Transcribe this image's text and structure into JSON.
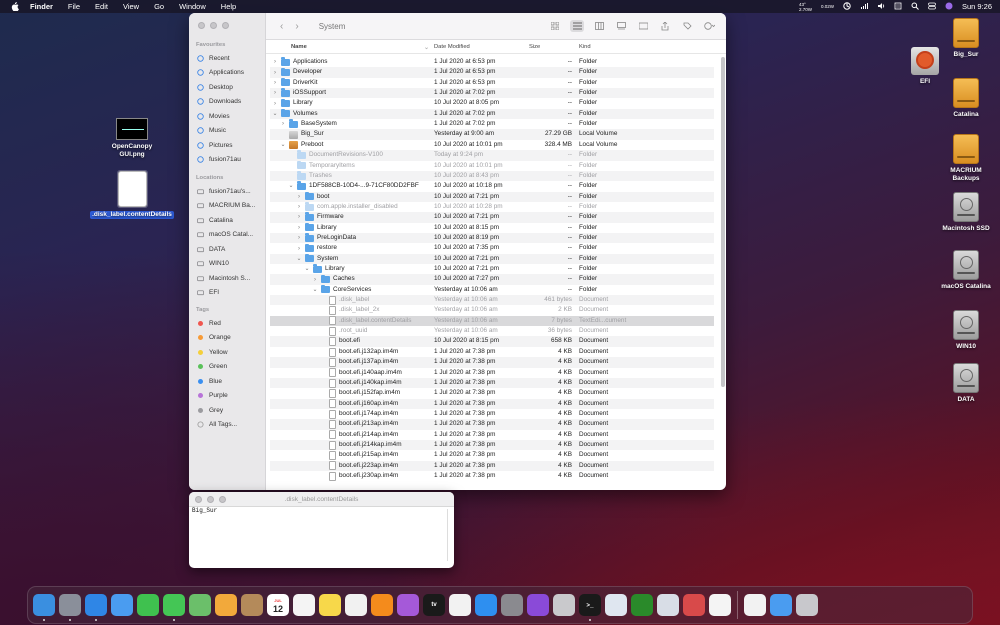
{
  "menubar": {
    "app": "Finder",
    "items": [
      "File",
      "Edit",
      "View",
      "Go",
      "Window",
      "Help"
    ],
    "temp": "43°",
    "temp_sub": "2.70W",
    "power": "0.02W",
    "clock": "Sun 9:26"
  },
  "finder": {
    "title": "System",
    "sidebar": {
      "favourites_head": "Favourites",
      "favourites": [
        "Recent",
        "Applications",
        "Desktop",
        "Downloads",
        "Movies",
        "Music",
        "Pictures",
        "fusion71au"
      ],
      "locations_head": "Locations",
      "locations": [
        "fusion71au's...",
        "MACRIUM Ba...",
        "Catalina",
        "macOS Catal...",
        "DATA",
        "WIN10",
        "Macintosh S...",
        "EFI"
      ],
      "tags_head": "Tags",
      "tags": [
        {
          "label": "Red",
          "color": "#f0564f"
        },
        {
          "label": "Orange",
          "color": "#f79a36"
        },
        {
          "label": "Yellow",
          "color": "#f4cf3a"
        },
        {
          "label": "Green",
          "color": "#5ac15a"
        },
        {
          "label": "Blue",
          "color": "#3a8ff0"
        },
        {
          "label": "Purple",
          "color": "#b874d8"
        },
        {
          "label": "Grey",
          "color": "#9b9b9f"
        },
        {
          "label": "All Tags...",
          "color": ""
        }
      ]
    },
    "columns": {
      "name": "Name",
      "date": "Date Modified",
      "size": "Size",
      "kind": "Kind"
    },
    "rows": [
      {
        "indent": 0,
        "chev": ">",
        "icon": "folder",
        "name": "Applications",
        "date": "1 Jul 2020 at 6:53 pm",
        "size": "--",
        "kind": "Folder"
      },
      {
        "indent": 0,
        "chev": ">",
        "icon": "folder",
        "name": "Developer",
        "date": "1 Jul 2020 at 6:53 pm",
        "size": "--",
        "kind": "Folder"
      },
      {
        "indent": 0,
        "chev": ">",
        "icon": "folder",
        "name": "DriverKit",
        "date": "1 Jul 2020 at 6:53 pm",
        "size": "--",
        "kind": "Folder"
      },
      {
        "indent": 0,
        "chev": ">",
        "icon": "folder",
        "name": "iOSSupport",
        "date": "1 Jul 2020 at 7:02 pm",
        "size": "--",
        "kind": "Folder"
      },
      {
        "indent": 0,
        "chev": ">",
        "icon": "folder",
        "name": "Library",
        "date": "10 Jul 2020 at 8:05 pm",
        "size": "--",
        "kind": "Folder"
      },
      {
        "indent": 0,
        "chev": "v",
        "icon": "folder",
        "name": "Volumes",
        "date": "1 Jul 2020 at 7:02 pm",
        "size": "--",
        "kind": "Folder"
      },
      {
        "indent": 1,
        "chev": ">",
        "icon": "folder",
        "name": "BaseSystem",
        "date": "1 Jul 2020 at 7:02 pm",
        "size": "--",
        "kind": "Folder"
      },
      {
        "indent": 1,
        "chev": "",
        "icon": "disk-grey",
        "name": "Big_Sur",
        "date": "Yesterday at 9:00 am",
        "size": "27.29 GB",
        "kind": "Local Volume"
      },
      {
        "indent": 1,
        "chev": "v",
        "icon": "disk",
        "name": "Preboot",
        "date": "10 Jul 2020 at 10:01 pm",
        "size": "328.4 MB",
        "kind": "Local Volume"
      },
      {
        "indent": 2,
        "chev": "",
        "icon": "folder-light",
        "name": "DocumentRevisions-V100",
        "date": "Today at 9:24 pm",
        "size": "--",
        "kind": "Folder",
        "grey": true
      },
      {
        "indent": 2,
        "chev": "",
        "icon": "folder-light",
        "name": "TemporaryItems",
        "date": "10 Jul 2020 at 10:01 pm",
        "size": "--",
        "kind": "Folder",
        "grey": true
      },
      {
        "indent": 2,
        "chev": "",
        "icon": "folder-light",
        "name": "Trashes",
        "date": "10 Jul 2020 at 8:43 pm",
        "size": "--",
        "kind": "Folder",
        "grey": true
      },
      {
        "indent": 2,
        "chev": "v",
        "icon": "folder",
        "name": "1DF588CB-10D4-...9-71CF80DD2FBF",
        "date": "10 Jul 2020 at 10:18 pm",
        "size": "--",
        "kind": "Folder"
      },
      {
        "indent": 3,
        "chev": ">",
        "icon": "folder",
        "name": "boot",
        "date": "10 Jul 2020 at 7:21 pm",
        "size": "--",
        "kind": "Folder"
      },
      {
        "indent": 3,
        "chev": ">",
        "icon": "folder-light",
        "name": "com.apple.installer_disabled",
        "date": "10 Jul 2020 at 10:28 pm",
        "size": "--",
        "kind": "Folder",
        "grey": true
      },
      {
        "indent": 3,
        "chev": ">",
        "icon": "folder",
        "name": "Firmware",
        "date": "10 Jul 2020 at 7:21 pm",
        "size": "--",
        "kind": "Folder"
      },
      {
        "indent": 3,
        "chev": ">",
        "icon": "folder",
        "name": "Library",
        "date": "10 Jul 2020 at 8:15 pm",
        "size": "--",
        "kind": "Folder"
      },
      {
        "indent": 3,
        "chev": ">",
        "icon": "folder",
        "name": "PreLoginData",
        "date": "10 Jul 2020 at 8:19 pm",
        "size": "--",
        "kind": "Folder"
      },
      {
        "indent": 3,
        "chev": ">",
        "icon": "folder",
        "name": "restore",
        "date": "10 Jul 2020 at 7:35 pm",
        "size": "--",
        "kind": "Folder"
      },
      {
        "indent": 3,
        "chev": "v",
        "icon": "folder",
        "name": "System",
        "date": "10 Jul 2020 at 7:21 pm",
        "size": "--",
        "kind": "Folder"
      },
      {
        "indent": 4,
        "chev": "v",
        "icon": "folder",
        "name": "Library",
        "date": "10 Jul 2020 at 7:21 pm",
        "size": "--",
        "kind": "Folder"
      },
      {
        "indent": 5,
        "chev": ">",
        "icon": "folder",
        "name": "Caches",
        "date": "10 Jul 2020 at 7:27 pm",
        "size": "--",
        "kind": "Folder"
      },
      {
        "indent": 5,
        "chev": "v",
        "icon": "folder",
        "name": "CoreServices",
        "date": "Yesterday at 10:06 am",
        "size": "--",
        "kind": "Folder"
      },
      {
        "indent": 6,
        "chev": "",
        "icon": "doc",
        "name": ".disk_label",
        "date": "Yesterday at 10:06 am",
        "size": "461 bytes",
        "kind": "Document",
        "grey": true
      },
      {
        "indent": 6,
        "chev": "",
        "icon": "doc",
        "name": ".disk_label_2x",
        "date": "Yesterday at 10:06 am",
        "size": "2 KB",
        "kind": "Document",
        "grey": true
      },
      {
        "indent": 6,
        "chev": "",
        "icon": "doc",
        "name": ".disk_label.contentDetails",
        "date": "Yesterday at 10:06 am",
        "size": "7 bytes",
        "kind": "TextEdi...cument",
        "grey": true,
        "selected": true
      },
      {
        "indent": 6,
        "chev": "",
        "icon": "doc",
        "name": ".root_uuid",
        "date": "Yesterday at 10:06 am",
        "size": "36 bytes",
        "kind": "Document",
        "grey": true
      },
      {
        "indent": 6,
        "chev": "",
        "icon": "doc",
        "name": "boot.efi",
        "date": "10 Jul 2020 at 8:15 pm",
        "size": "658 KB",
        "kind": "Document"
      },
      {
        "indent": 6,
        "chev": "",
        "icon": "doc",
        "name": "boot.efi.j132ap.im4m",
        "date": "1 Jul 2020 at 7:38 pm",
        "size": "4 KB",
        "kind": "Document"
      },
      {
        "indent": 6,
        "chev": "",
        "icon": "doc",
        "name": "boot.efi.j137ap.im4m",
        "date": "1 Jul 2020 at 7:38 pm",
        "size": "4 KB",
        "kind": "Document"
      },
      {
        "indent": 6,
        "chev": "",
        "icon": "doc",
        "name": "boot.efi.j140aap.im4m",
        "date": "1 Jul 2020 at 7:38 pm",
        "size": "4 KB",
        "kind": "Document"
      },
      {
        "indent": 6,
        "chev": "",
        "icon": "doc",
        "name": "boot.efi.j140kap.im4m",
        "date": "1 Jul 2020 at 7:38 pm",
        "size": "4 KB",
        "kind": "Document"
      },
      {
        "indent": 6,
        "chev": "",
        "icon": "doc",
        "name": "boot.efi.j152fap.im4m",
        "date": "1 Jul 2020 at 7:38 pm",
        "size": "4 KB",
        "kind": "Document"
      },
      {
        "indent": 6,
        "chev": "",
        "icon": "doc",
        "name": "boot.efi.j160ap.im4m",
        "date": "1 Jul 2020 at 7:38 pm",
        "size": "4 KB",
        "kind": "Document"
      },
      {
        "indent": 6,
        "chev": "",
        "icon": "doc",
        "name": "boot.efi.j174ap.im4m",
        "date": "1 Jul 2020 at 7:38 pm",
        "size": "4 KB",
        "kind": "Document"
      },
      {
        "indent": 6,
        "chev": "",
        "icon": "doc",
        "name": "boot.efi.j213ap.im4m",
        "date": "1 Jul 2020 at 7:38 pm",
        "size": "4 KB",
        "kind": "Document"
      },
      {
        "indent": 6,
        "chev": "",
        "icon": "doc",
        "name": "boot.efi.j214ap.im4m",
        "date": "1 Jul 2020 at 7:38 pm",
        "size": "4 KB",
        "kind": "Document"
      },
      {
        "indent": 6,
        "chev": "",
        "icon": "doc",
        "name": "boot.efi.j214kap.im4m",
        "date": "1 Jul 2020 at 7:38 pm",
        "size": "4 KB",
        "kind": "Document"
      },
      {
        "indent": 6,
        "chev": "",
        "icon": "doc",
        "name": "boot.efi.j215ap.im4m",
        "date": "1 Jul 2020 at 7:38 pm",
        "size": "4 KB",
        "kind": "Document"
      },
      {
        "indent": 6,
        "chev": "",
        "icon": "doc",
        "name": "boot.efi.j223ap.im4m",
        "date": "1 Jul 2020 at 7:38 pm",
        "size": "4 KB",
        "kind": "Document"
      },
      {
        "indent": 6,
        "chev": "",
        "icon": "doc",
        "name": "boot.efi.j230ap.im4m",
        "date": "1 Jul 2020 at 7:38 pm",
        "size": "4 KB",
        "kind": "Document"
      }
    ]
  },
  "textedit": {
    "title": ".disk_label.contentDetails",
    "content": "Big_Sur"
  },
  "desktop": {
    "left_icons": [
      {
        "label": "OpenCanopy GUI.png"
      },
      {
        "label": ".disk_label.contentDetails"
      }
    ],
    "right_icons": [
      {
        "label": "Big_Sur",
        "icon": "hdd-orange"
      },
      {
        "label": "EFI",
        "icon": "efi-ubuntu"
      },
      {
        "label": "Catalina",
        "icon": "hdd-orange"
      },
      {
        "label": "MACRIUM Backups",
        "icon": "hdd-orange"
      },
      {
        "label": "Macintosh SSD",
        "icon": "hdd-grey"
      },
      {
        "label": "macOS Catalina",
        "icon": "hdd-grey"
      },
      {
        "label": "WIN10",
        "icon": "hdd-grey"
      },
      {
        "label": "DATA",
        "icon": "hdd-grey"
      }
    ]
  },
  "dock": {
    "apps": [
      {
        "name": "finder-icon",
        "color": "#3a8fe0"
      },
      {
        "name": "launchpad-icon",
        "color": "#8a8f9a"
      },
      {
        "name": "safari-icon",
        "color": "#2f86e6"
      },
      {
        "name": "mail-icon",
        "color": "#4a9cf0"
      },
      {
        "name": "facetime-icon",
        "color": "#3fc14f"
      },
      {
        "name": "messages-icon",
        "color": "#44c655"
      },
      {
        "name": "maps-icon",
        "color": "#6bbf6a"
      },
      {
        "name": "photos-icon",
        "color": "#f2a93b"
      },
      {
        "name": "contacts-icon",
        "color": "#b48a5a"
      },
      {
        "name": "calendar-icon",
        "color": "#ffffff"
      },
      {
        "name": "reminders-icon",
        "color": "#f4f4f4"
      },
      {
        "name": "notes-icon",
        "color": "#f7d84a"
      },
      {
        "name": "music-icon",
        "color": "#f1f1f1"
      },
      {
        "name": "vlc-icon",
        "color": "#f48b1c"
      },
      {
        "name": "podcasts-icon",
        "color": "#a559d9"
      },
      {
        "name": "tv-icon",
        "color": "#1a1a1a"
      },
      {
        "name": "news-icon",
        "color": "#f2f2f2"
      },
      {
        "name": "app-store-icon",
        "color": "#2e8ff0"
      },
      {
        "name": "system-preferences-icon",
        "color": "#8a8a8f"
      },
      {
        "name": "feedback-icon",
        "color": "#8a4ad8"
      },
      {
        "name": "disk-utility-icon",
        "color": "#c9c9cc"
      },
      {
        "name": "terminal-icon",
        "color": "#1a1a1a"
      },
      {
        "name": "activity-monitor-icon",
        "color": "#dfe6f0"
      },
      {
        "name": "cpu-monitor-icon",
        "color": "#2a8a2a"
      },
      {
        "name": "preview-icon",
        "color": "#d8dde6"
      },
      {
        "name": "tools-icon",
        "color": "#d84a4a"
      },
      {
        "name": "textedit-icon",
        "color": "#f4f4f4"
      }
    ],
    "right": [
      {
        "name": "document-icon",
        "color": "#f2f2f2"
      },
      {
        "name": "folder-icon",
        "color": "#4a9cf0"
      },
      {
        "name": "trash-icon",
        "color": "#c8c8cc"
      }
    ],
    "calendar_day": "12",
    "calendar_month": "JUL"
  }
}
